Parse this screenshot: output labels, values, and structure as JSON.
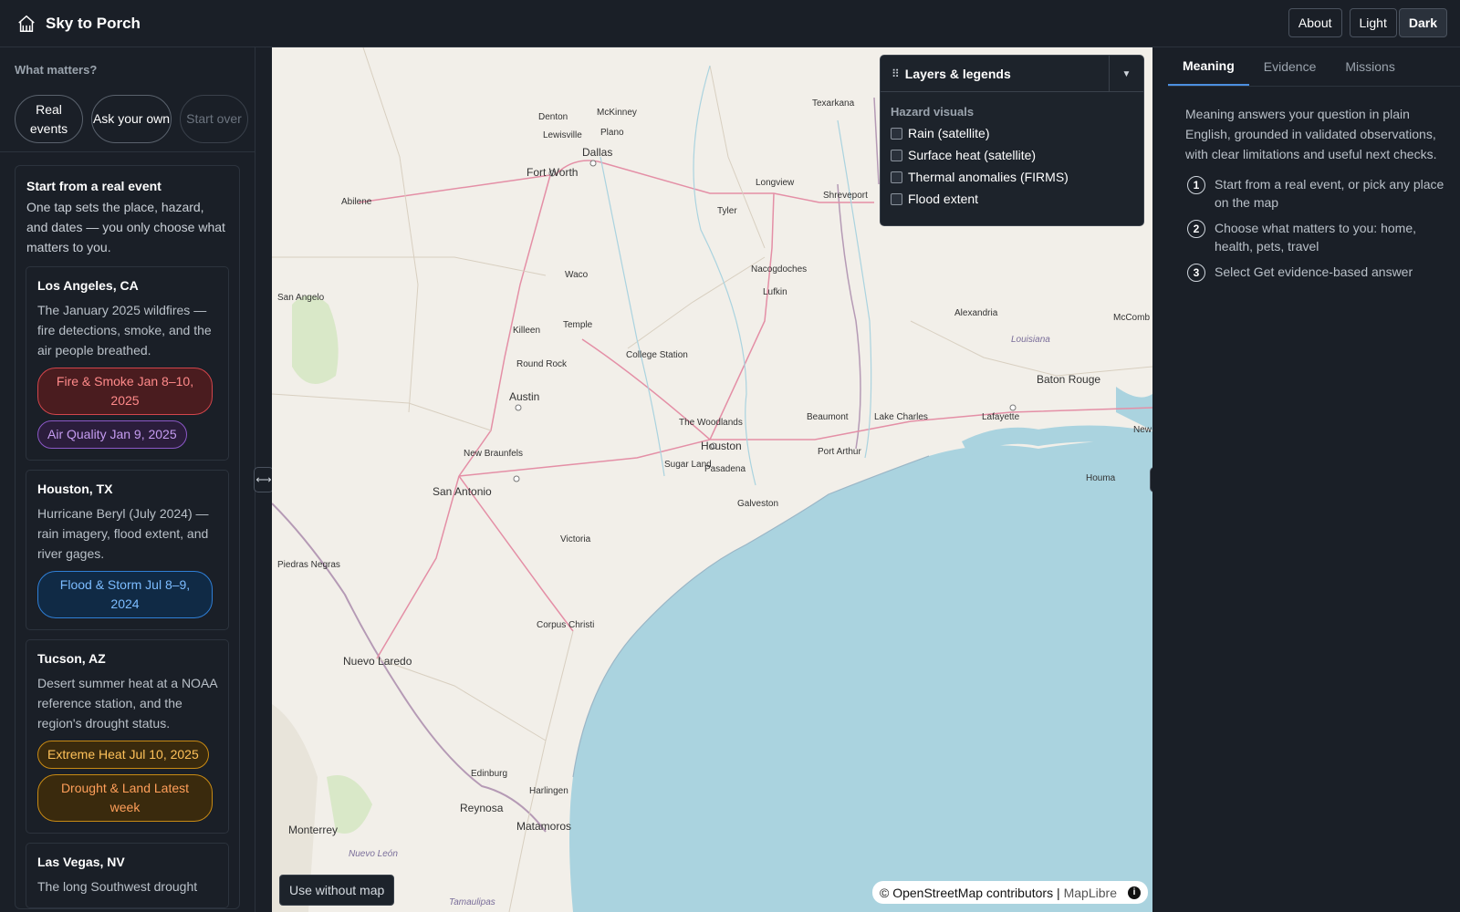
{
  "header": {
    "title": "Sky to Porch",
    "about": "About",
    "light": "Light",
    "dark": "Dark"
  },
  "left": {
    "prompt": "What matters?",
    "pills": [
      "Real events",
      "Ask your own",
      "Start over"
    ],
    "events_heading": "Start from a real event",
    "events_intro": "One tap sets the place, hazard, and dates — you only choose what matters to you.",
    "cards": [
      {
        "title": "Los Angeles, CA",
        "desc": "The January 2025 wildfires — fire detections, smoke, and the air people breathed.",
        "chips": [
          "Fire & Smoke  Jan 8–10, 2025",
          "Air Quality  Jan 9, 2025"
        ]
      },
      {
        "title": "Houston, TX",
        "desc": "Hurricane Beryl (July 2024) — rain imagery, flood extent, and river gages.",
        "chips": [
          "Flood & Storm  Jul 8–9, 2024"
        ]
      },
      {
        "title": "Tucson, AZ",
        "desc": "Desert summer heat at a NOAA reference station, and the region's drought status.",
        "chips": [
          "Extreme Heat  Jul 10, 2025",
          "Drought & Land  Latest week"
        ]
      },
      {
        "title": "Las Vegas, NV",
        "desc": "The long Southwest drought"
      }
    ]
  },
  "map": {
    "layers_title": "Layers & legends",
    "hazard_heading": "Hazard visuals",
    "options": [
      "Rain (satellite)",
      "Surface heat (satellite)",
      "Thermal anomalies (FIRMS)",
      "Flood extent"
    ],
    "use_without_map": "Use without map",
    "attribution": "© OpenStreetMap contributors | ",
    "maplibre": "MapLibre",
    "labels": {
      "denton": "Denton",
      "mckinney": "McKinney",
      "lewisville": "Lewisville",
      "plano": "Plano",
      "dallas": "Dallas",
      "fortworth": "Fort Worth",
      "texarkana": "Texarkana",
      "longview": "Longview",
      "shreveport": "Shreveport",
      "tyler": "Tyler",
      "abilene": "Abilene",
      "waco": "Waco",
      "sanangelo": "San Angelo",
      "nacogdoches": "Nacogdoches",
      "lufkin": "Lufkin",
      "killeen": "Killeen",
      "temple": "Temple",
      "alexandria": "Alexandria",
      "mccomb": "McComb",
      "louisiana": "Louisiana",
      "roundrock": "Round Rock",
      "collegestation": "College Station",
      "batonrouge": "Baton Rouge",
      "austin": "Austin",
      "woodlands": "The Woodlands",
      "beaumont": "Beaumont",
      "lakecharles": "Lake Charles",
      "lafayette": "Lafayette",
      "newbraunfels": "New Braunfels",
      "houston": "Houston",
      "portarthur": "Port Arthur",
      "sugarland": "Sugar Land",
      "pasadena": "Pasadena",
      "sanantonio": "San Antonio",
      "houma": "Houma",
      "galveston": "Galveston",
      "victoria": "Victoria",
      "piedras": "Piedras Negras",
      "corpus": "Corpus Christi",
      "nuevolaredo": "Nuevo Laredo",
      "edinburg": "Edinburg",
      "harlingen": "Harlingen",
      "reynosa": "Reynosa",
      "matamoros": "Matamoros",
      "monterrey": "Monterrey",
      "nuevoleon": "Nuevo León",
      "tamaulipas": "Tamaulipas",
      "new": "New"
    }
  },
  "right": {
    "tabs": [
      "Meaning",
      "Evidence",
      "Missions"
    ],
    "meaning": "Meaning answers your question in plain English, grounded in validated observations, with clear limitations and useful next checks.",
    "steps": [
      {
        "n": "1",
        "text": "Start from a real event, or pick any place on the map"
      },
      {
        "n": "2",
        "text": "Choose what matters to you: home, health, pets, travel"
      },
      {
        "n": "3",
        "text": "Select Get evidence-based answer"
      }
    ]
  }
}
